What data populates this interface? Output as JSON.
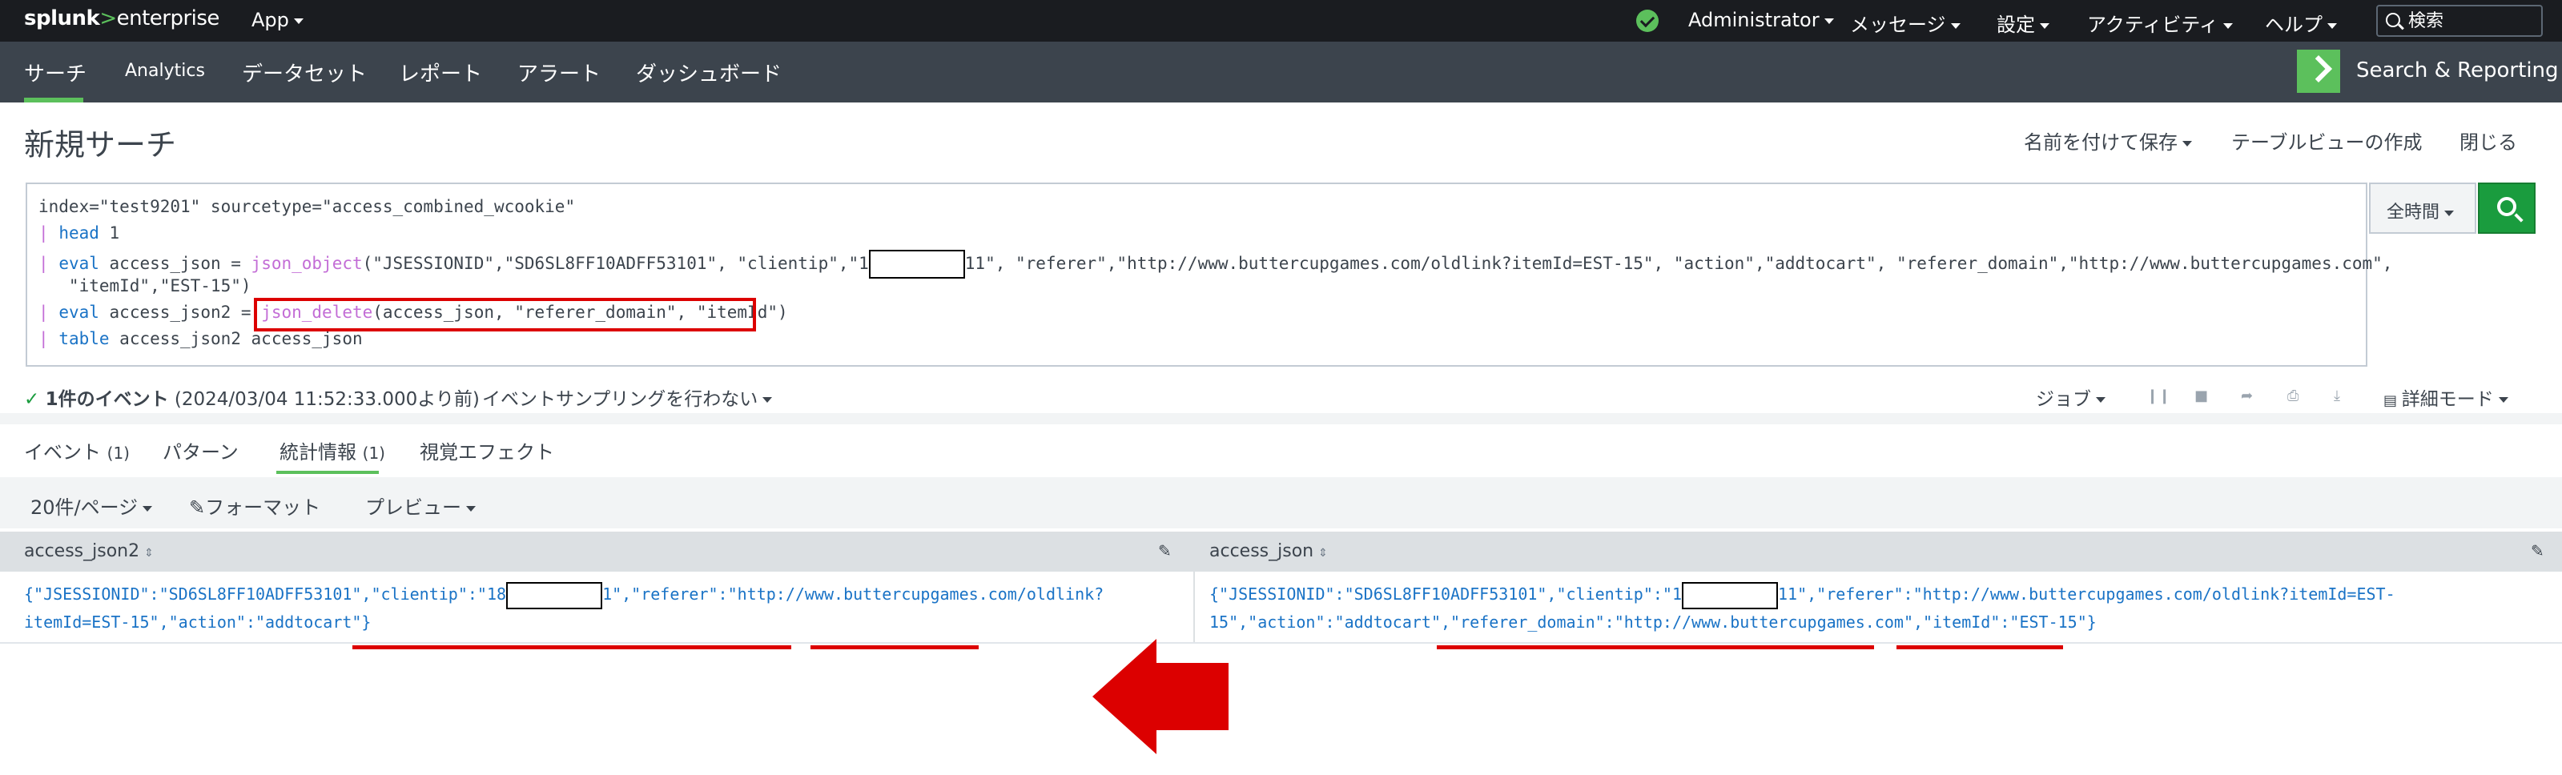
{
  "topbar": {
    "logo_main": "splunk",
    "logo_gt": ">",
    "logo_suffix": "enterprise",
    "app_menu": "App",
    "user": "Administrator",
    "messages": "メッセージ",
    "settings": "設定",
    "activity": "アクティビティ",
    "help": "ヘルプ",
    "search_placeholder": "検索"
  },
  "appbar": {
    "nav": [
      "サーチ",
      "Analytics",
      "データセット",
      "レポート",
      "アラート",
      "ダッシュボード"
    ],
    "app_title": "Search & Reporting"
  },
  "page": {
    "title": "新規サーチ",
    "save_as": "名前を付けて保存",
    "create_table_view": "テーブルビューの作成",
    "close": "閉じる"
  },
  "query": {
    "line1": "index=\"test9201\" sourcetype=\"access_combined_wcookie\"",
    "line2_pipe": "|",
    "line2_cmd": "head",
    "line2_rest": " 1",
    "line3_pipe": "|",
    "line3_cmd": "eval",
    "line3_a": " access_json = ",
    "line3_fn": "json_object",
    "line3_b": "(\"JSESSIONID\",\"SD6SL8FF10ADFF53101\", \"clientip\",\"1",
    "line3_c": "11\", \"referer\",\"http://www.buttercupgames.com/oldlink?itemId=EST-15\", \"action\",\"addtocart\", \"referer_domain\",\"http://www.buttercupgames.com\",",
    "line4": "   \"itemId\",\"EST-15\")",
    "line5_pipe": "|",
    "line5_cmd": "eval",
    "line5_a": " access_json2 = ",
    "line5_fn": "json_delete",
    "line5_b": "(access_json, \"referer_domain\", \"itemId\")",
    "line6_pipe": "|",
    "line6_cmd": "table",
    "line6_rest": " access_json2 access_json"
  },
  "time_picker": "全時間",
  "status": {
    "check": "✓",
    "count": "1件のイベント",
    "timestamp": "(2024/03/04 11:52:33.000より前)",
    "sampling": "イベントサンプリングを行わない",
    "job": "ジョブ",
    "detail_mode": "詳細モード"
  },
  "tabs": [
    {
      "label": "イベント",
      "count": "(1)"
    },
    {
      "label": "パターン",
      "count": ""
    },
    {
      "label": "統計情報",
      "count": "(1)"
    },
    {
      "label": "視覚エフェクト",
      "count": ""
    }
  ],
  "toolbar": {
    "per_page": "20件/ページ",
    "format": "フォーマット",
    "preview": "プレビュー"
  },
  "table": {
    "columns": [
      "access_json2",
      "access_json"
    ],
    "row": {
      "c1_line1a": "{\"JSESSIONID\":\"SD6SL8FF10ADFF53101\",\"clientip\":\"18",
      "c1_line1b": "1\",\"referer\":\"http://www.buttercupgames.com/oldlink?",
      "c1_line2": "itemId=EST-15\",\"action\":\"addtocart\"}",
      "c2_line1a": "{\"JSESSIONID\":\"SD6SL8FF10ADFF53101\",\"clientip\":\"1",
      "c2_line1b": "11\",\"referer\":\"http://www.buttercupgames.com/oldlink?itemId=EST-",
      "c2_line2": "15\",\"action\":\"addtocart\",\"referer_domain\":\"http://www.buttercupgames.com\",\"itemId\":\"EST-15\"}"
    }
  },
  "colors": {
    "topbar": "#1a1c20",
    "appbar": "#3c444d",
    "accent": "#5cc05c",
    "search_button": "#1a9c3e",
    "annotation_red": "#dc0000"
  }
}
